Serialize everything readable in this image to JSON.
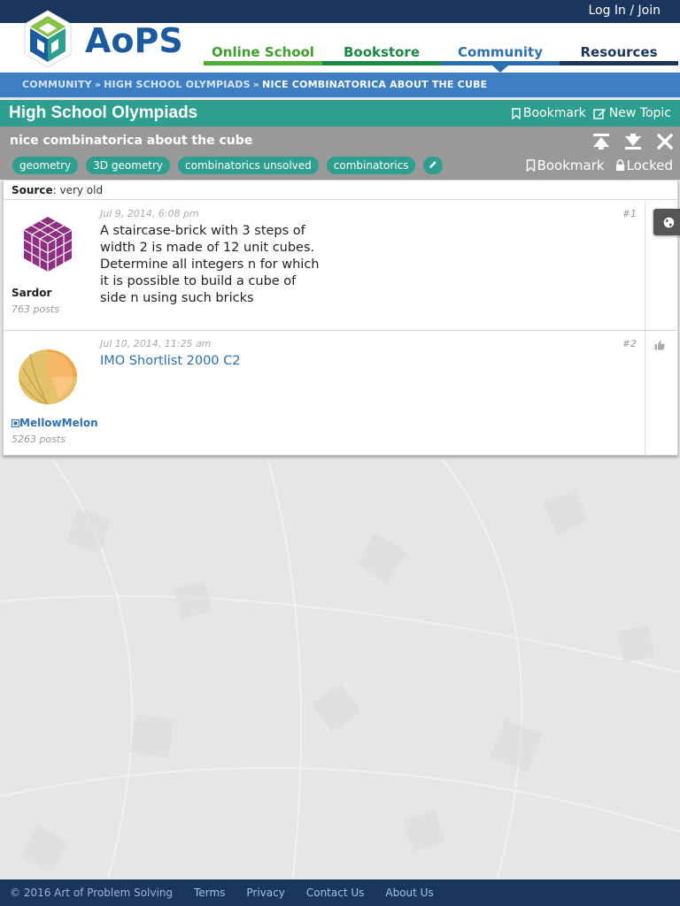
{
  "topbar": {
    "login_label": "Log In / Join"
  },
  "logo": {
    "text": "AoPS"
  },
  "nav": {
    "online_school": "Online School",
    "bookstore": "Bookstore",
    "community": "Community",
    "resources": "Resources"
  },
  "breadcrumb": {
    "community": "COMMUNITY",
    "forum": "HIGH SCHOOL OLYMPIADS",
    "current": "NICE COMBINATORICA ABOUT THE CUBE",
    "separator": "»"
  },
  "forum": {
    "title": "High School Olympiads",
    "bookmark_label": "Bookmark",
    "new_topic_label": "New Topic"
  },
  "topic": {
    "title": "nice combinatorica about the cube",
    "tags": [
      "geometry",
      "3D geometry",
      "combinatorics unsolved",
      "combinatorics"
    ],
    "bookmark_label": "Bookmark",
    "locked_label": "Locked"
  },
  "source": {
    "label": "Source",
    "value": ": very old"
  },
  "posts": [
    {
      "username": "Sardor",
      "post_count": "763 posts",
      "date": "Jul 9, 2014, 6:08 pm",
      "number": "#1",
      "body": "A staircase-brick with 3 steps of width 2 is made of 12 unit cubes. Determine all integers n for which it is possible to build a cube of side n using such bricks"
    },
    {
      "username": "MellowMelon",
      "post_count": "5263 posts",
      "date": "Jul 10, 2014, 11:25 am",
      "number": "#2",
      "body": "IMO Shortlist 2000 C2"
    }
  ],
  "footer": {
    "copyright": "© 2016 Art of Problem Solving",
    "terms": "Terms",
    "privacy": "Privacy",
    "contact": "Contact Us",
    "about": "About Us"
  },
  "colors": {
    "navy": "#1b365d",
    "teal": "#2e9f8e",
    "blue": "#2c6fb3",
    "green": "#4fae3a",
    "gray_bar": "#999999"
  }
}
